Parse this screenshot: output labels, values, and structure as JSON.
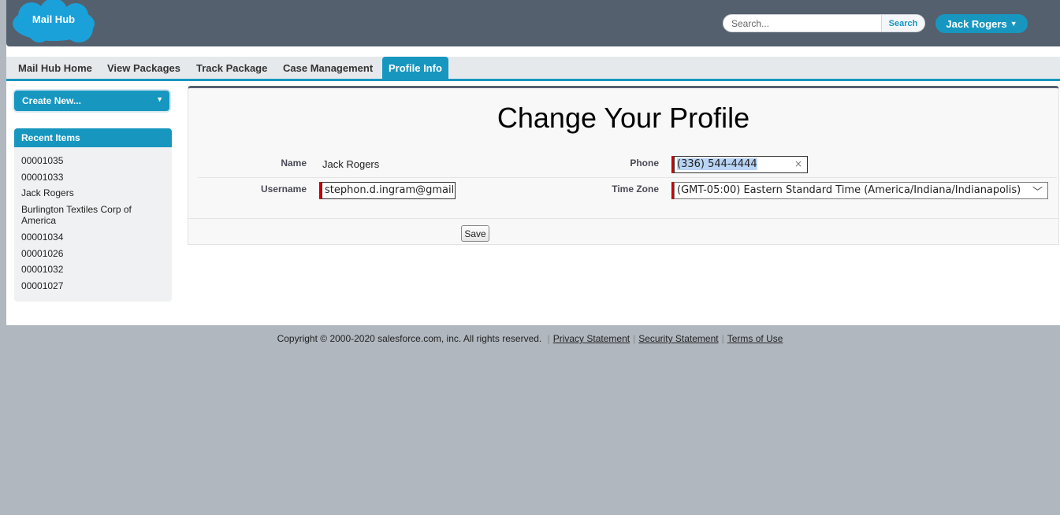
{
  "header": {
    "logo_text": "Mail Hub",
    "search_placeholder": "Search...",
    "search_button": "Search",
    "user_menu": "Jack Rogers"
  },
  "tabs": [
    {
      "label": "Mail Hub Home",
      "active": false
    },
    {
      "label": "View Packages",
      "active": false
    },
    {
      "label": "Track Package",
      "active": false
    },
    {
      "label": "Case Management",
      "active": false
    },
    {
      "label": "Profile Info",
      "active": true
    }
  ],
  "sidebar": {
    "create_new": "Create New...",
    "recent_title": "Recent Items",
    "recent_items": [
      "00001035",
      "00001033",
      "Jack Rogers",
      "Burlington Textiles Corp of America",
      "00001034",
      "00001026",
      "00001032",
      "00001027"
    ]
  },
  "profile": {
    "title": "Change Your Profile",
    "name_label": "Name",
    "name_value": "Jack Rogers",
    "username_label": "Username",
    "username_value": "stephon.d.ingram@gmail.c",
    "phone_label": "Phone",
    "phone_value": "(336) 544-4444",
    "timezone_label": "Time Zone",
    "timezone_value": "(GMT-05:00) Eastern Standard Time (America/Indiana/Indianapolis)",
    "save_button": "Save"
  },
  "footer": {
    "copyright": "Copyright © 2000-2020 salesforce.com, inc. All rights reserved.",
    "privacy": "Privacy Statement",
    "security": "Security Statement",
    "terms": "Terms of Use"
  },
  "colors": {
    "accent": "#1797c0",
    "header_bg": "#54606e",
    "required": "#cc0000"
  }
}
